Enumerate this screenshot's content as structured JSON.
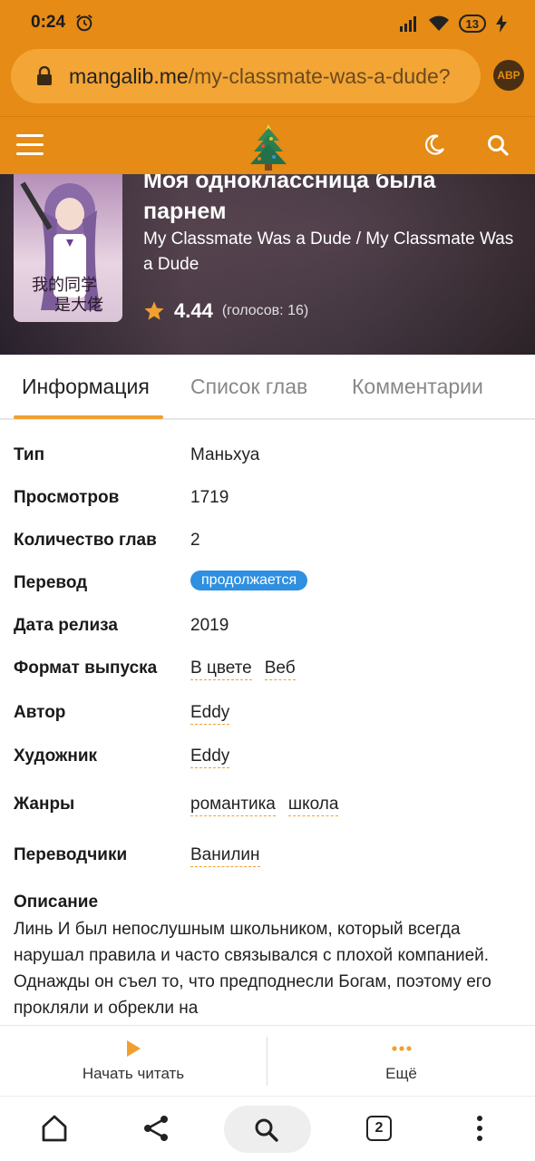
{
  "status_bar": {
    "time": "0:24",
    "battery": "13"
  },
  "browser": {
    "url_domain": "mangalib.me",
    "url_path": "/my-classmate-was-a-dude?",
    "abp_label": "ABP",
    "tab_count": "2"
  },
  "colors": {
    "brand": "#e58b16",
    "badge": "#2f8fe0",
    "accent": "#f0a030"
  },
  "manga": {
    "title_ru": "Моя одноклассница была парнем",
    "title_en": "My Classmate Was a Dude / My Classmate Was a Dude",
    "rating": "4.44",
    "votes": "(голосов: 16)"
  },
  "tabs": [
    {
      "label": "Информация",
      "active": true
    },
    {
      "label": "Список глав",
      "active": false
    },
    {
      "label": "Комментарии",
      "active": false
    }
  ],
  "info": {
    "type_label": "Тип",
    "type_value": "Маньхуа",
    "views_label": "Просмотров",
    "views_value": "1719",
    "chapters_label": "Количество глав",
    "chapters_value": "2",
    "translation_label": "Перевод",
    "translation_value": "продолжается",
    "release_label": "Дата релиза",
    "release_value": "2019",
    "format_label": "Формат выпуска",
    "format_values": [
      "В цвете",
      "Веб"
    ],
    "author_label": "Автор",
    "author_value": "Eddy",
    "artist_label": "Художник",
    "artist_value": "Eddy",
    "genres_label": "Жанры",
    "genres_values": [
      "романтика",
      "школа"
    ],
    "translators_label": "Переводчики",
    "translators_value": "Ванилин"
  },
  "description": {
    "label": "Описание",
    "text": " Линь И был непослушным школьником, который всегда нарушал правила и часто связывался с плохой компанией. Однажды он съел то, что предподнесли Богам, поэтому его прокляли и обрекли на"
  },
  "actions": {
    "start_reading": "Начать читать",
    "more": "Ещё"
  },
  "icons": [
    "lock-icon",
    "menu-icon",
    "tree-logo-icon",
    "moon-icon",
    "search-icon",
    "star-icon",
    "play-icon",
    "dots-icon",
    "home-icon",
    "share-icon",
    "tabs-icon",
    "more-vert-icon"
  ]
}
